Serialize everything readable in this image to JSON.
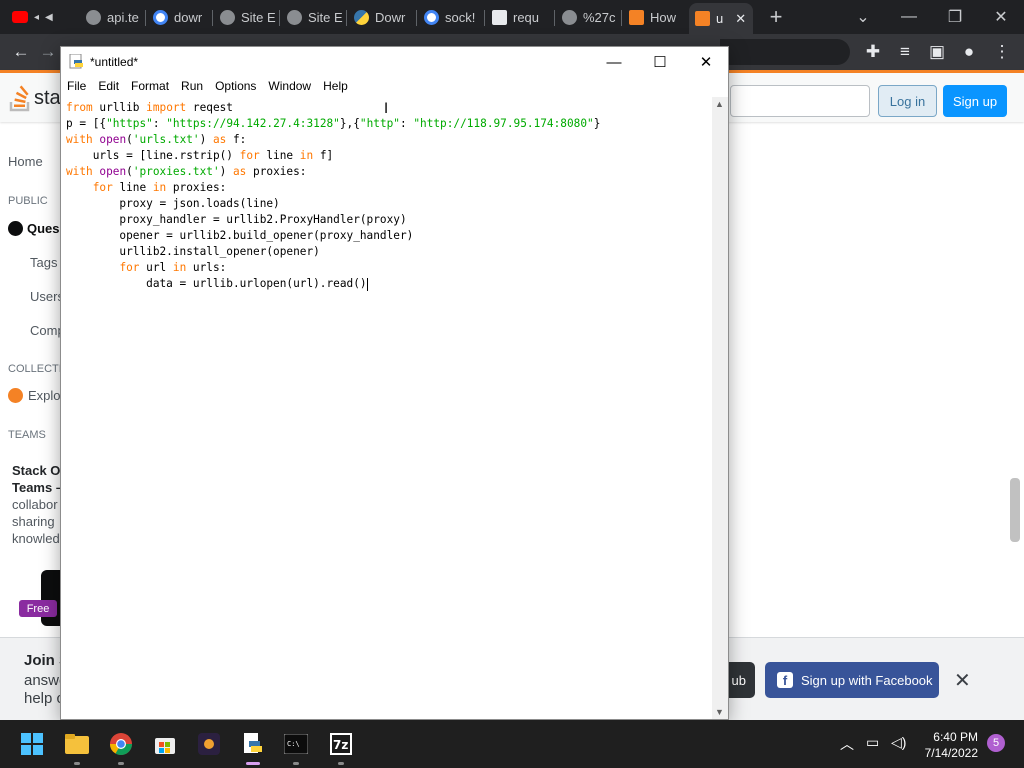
{
  "browser": {
    "tabs": [
      {
        "label": "",
        "icon": "youtube-icon"
      },
      {
        "label": "api.te",
        "icon": "globe-icon"
      },
      {
        "label": "dowr",
        "icon": "google-icon"
      },
      {
        "label": "Site E",
        "icon": "globe-icon"
      },
      {
        "label": "Site E",
        "icon": "globe-icon"
      },
      {
        "label": "Dowr",
        "icon": "python-icon"
      },
      {
        "label": "sock!",
        "icon": "google-icon"
      },
      {
        "label": "requ",
        "icon": "package-icon"
      },
      {
        "label": "%27c",
        "icon": "globe-icon"
      },
      {
        "label": "How",
        "icon": "stackoverflow-icon"
      },
      {
        "label": "u",
        "icon": "stackoverflow-icon"
      }
    ],
    "new_tab": "+"
  },
  "so_page": {
    "logo_text": "sta",
    "login": "Log in",
    "signup": "Sign up",
    "nav": {
      "home": "Home",
      "public": "PUBLIC",
      "questions": "Ques",
      "tags": "Tags",
      "users": "Users",
      "companies": "Comp",
      "collectives": "COLLECTIV",
      "explore": "Explo",
      "teams": "TEAMS"
    },
    "teams_promo": {
      "title": "Stack O",
      "title2": "Teams –",
      "line1": "collabor",
      "line2": "sharing",
      "line3": "knowled"
    },
    "free_badge": "Free",
    "banner": {
      "title": "Join S",
      "line1": "answe",
      "line2": "help c",
      "github_btn": "ub",
      "facebook_btn": "Sign up with Facebook",
      "close": "✕"
    }
  },
  "idle": {
    "title": "*untitled*",
    "menu": [
      "File",
      "Edit",
      "Format",
      "Run",
      "Options",
      "Window",
      "Help"
    ],
    "code": [
      [
        {
          "t": "from",
          "c": "kw"
        },
        {
          "t": " urllib "
        },
        {
          "t": "import",
          "c": "kw"
        },
        {
          "t": " reqest"
        }
      ],
      [
        {
          "t": "p = [{"
        },
        {
          "t": "\"https\"",
          "c": "str"
        },
        {
          "t": ": "
        },
        {
          "t": "\"https://94.142.27.4:3128\"",
          "c": "str"
        },
        {
          "t": "},{"
        },
        {
          "t": "\"http\"",
          "c": "str"
        },
        {
          "t": ": "
        },
        {
          "t": "\"http://118.97.95.174:8080\"",
          "c": "str"
        },
        {
          "t": "}"
        }
      ],
      [
        {
          "t": "with",
          "c": "kw"
        },
        {
          "t": " "
        },
        {
          "t": "open",
          "c": "bi"
        },
        {
          "t": "("
        },
        {
          "t": "'urls.txt'",
          "c": "str"
        },
        {
          "t": ") "
        },
        {
          "t": "as",
          "c": "kw"
        },
        {
          "t": " f:"
        }
      ],
      [
        {
          "t": "    urls = [line.rstrip() "
        },
        {
          "t": "for",
          "c": "kw"
        },
        {
          "t": " line "
        },
        {
          "t": "in",
          "c": "kw"
        },
        {
          "t": " f]"
        }
      ],
      [
        {
          "t": "with",
          "c": "kw"
        },
        {
          "t": " "
        },
        {
          "t": "open",
          "c": "bi"
        },
        {
          "t": "("
        },
        {
          "t": "'proxies.txt'",
          "c": "str"
        },
        {
          "t": ") "
        },
        {
          "t": "as",
          "c": "kw"
        },
        {
          "t": " proxies:"
        }
      ],
      [
        {
          "t": "    "
        },
        {
          "t": "for",
          "c": "kw"
        },
        {
          "t": " line "
        },
        {
          "t": "in",
          "c": "kw"
        },
        {
          "t": " proxies:"
        }
      ],
      [
        {
          "t": "        proxy = json.loads(line)"
        }
      ],
      [
        {
          "t": "        proxy_handler = urllib2.ProxyHandler(proxy)"
        }
      ],
      [
        {
          "t": "        opener = urllib2.build_opener(proxy_handler)"
        }
      ],
      [
        {
          "t": "        urllib2.install_opener(opener)"
        }
      ],
      [
        {
          "t": "        "
        },
        {
          "t": "for",
          "c": "kw"
        },
        {
          "t": " url "
        },
        {
          "t": "in",
          "c": "kw"
        },
        {
          "t": " urls:"
        }
      ],
      [
        {
          "t": "            data = urllib.urlopen(url).read()"
        }
      ]
    ]
  },
  "taskbar": {
    "time": "6:40 PM",
    "date": "7/14/2022",
    "notifications": "5",
    "apps": [
      "start-icon",
      "file-explorer-icon",
      "chrome-icon",
      "store-icon",
      "app-icon",
      "python-idle-icon",
      "terminal-icon",
      "7zip-icon"
    ]
  },
  "colors": {
    "keyword": "#ff7700",
    "builtin": "#900090",
    "string": "#00aa00",
    "so_orange": "#f48225",
    "so_blue": "#0a95ff",
    "facebook": "#385499"
  }
}
